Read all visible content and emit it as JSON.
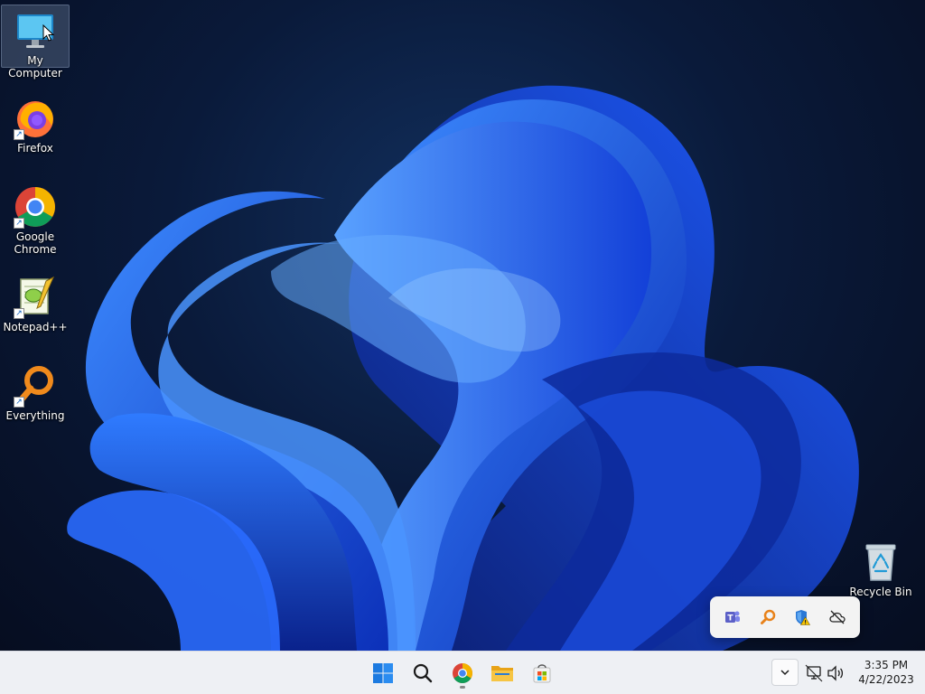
{
  "desktop": {
    "icons": [
      {
        "label": "My Computer",
        "icon": "monitor-icon",
        "selected": true
      },
      {
        "label": "Firefox",
        "icon": "firefox-icon"
      },
      {
        "label": "Google Chrome",
        "icon": "chrome-icon"
      },
      {
        "label": "Notepad++",
        "icon": "notepadpp-icon"
      },
      {
        "label": "Everything",
        "icon": "everything-search-icon"
      },
      {
        "label": "Recycle Bin",
        "icon": "recycle-bin-icon"
      }
    ]
  },
  "tray_flyout": {
    "icons": [
      "teams-icon",
      "everything-tray-icon",
      "defender-warning-icon",
      "onedrive-offline-icon"
    ]
  },
  "taskbar": {
    "apps": [
      "start-button",
      "search-button",
      "chrome-taskbar-icon",
      "file-explorer-icon",
      "store-icon"
    ],
    "clock": {
      "time": "3:35 PM",
      "date": "4/22/2023"
    }
  },
  "colors": {
    "taskbar_bg": "#eef0f4",
    "wallpaper_accent": "#1e63ff",
    "wallpaper_dark": "#060d20"
  }
}
